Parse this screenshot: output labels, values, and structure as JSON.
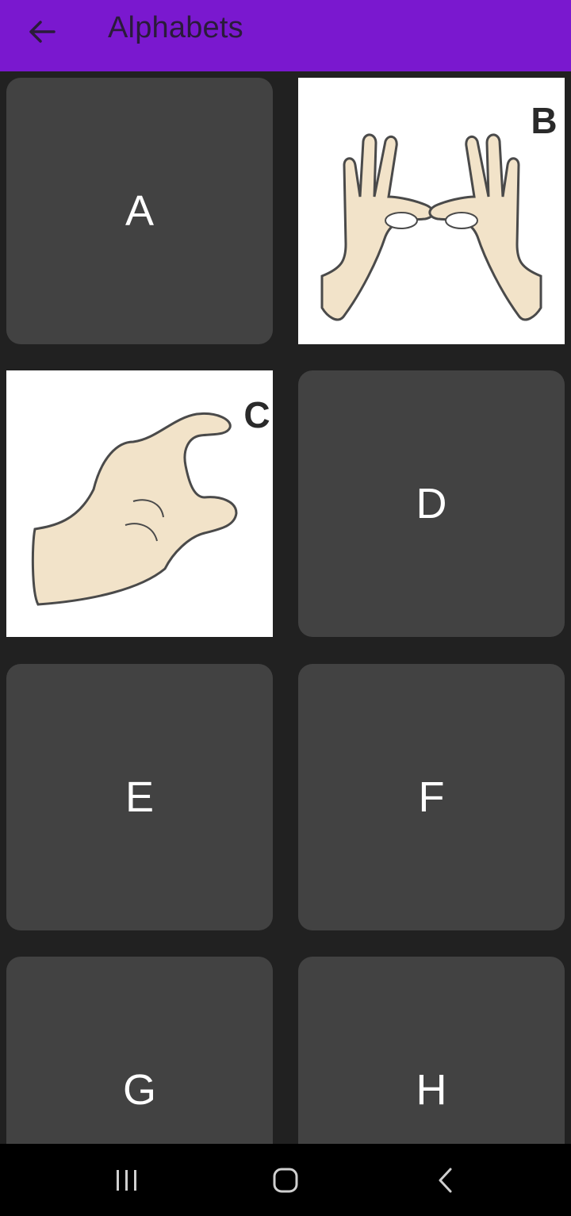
{
  "appbar": {
    "title": "Alphabets",
    "color": "#7a18cf",
    "back_icon": "arrow-left-icon"
  },
  "tiles": [
    {
      "letter": "A",
      "kind": "text"
    },
    {
      "letter": "B",
      "kind": "image",
      "image_label": "B"
    },
    {
      "letter": "C",
      "kind": "image",
      "image_label": "C"
    },
    {
      "letter": "D",
      "kind": "text"
    },
    {
      "letter": "E",
      "kind": "text"
    },
    {
      "letter": "F",
      "kind": "text"
    },
    {
      "letter": "G",
      "kind": "text"
    },
    {
      "letter": "H",
      "kind": "text"
    }
  ],
  "system_nav": {
    "recents_icon": "recents-icon",
    "home_icon": "home-icon",
    "back_icon": "back-chevron-icon"
  }
}
